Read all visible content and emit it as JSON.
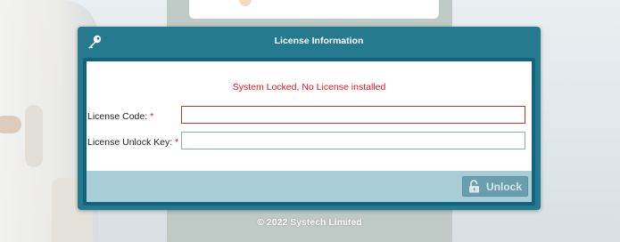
{
  "footer": {
    "copyright": "© 2022 Systech Limited"
  },
  "dialog": {
    "title": "License Information",
    "icon": "key-icon",
    "status_message": "System Locked, No License installed",
    "fields": [
      {
        "label": "License Code:",
        "required_mark": "*",
        "value": "",
        "placeholder": "",
        "state": "error"
      },
      {
        "label": "License Unlock Key:",
        "required_mark": "*",
        "value": "",
        "placeholder": "",
        "state": "normal"
      }
    ],
    "unlock_button": {
      "label": "Unlock",
      "icon": "unlock-icon",
      "enabled": false
    }
  },
  "colors": {
    "header": "#257a8f",
    "frame": "#10657c",
    "error_text": "#e0161c",
    "footer_bar": "#a9cdd6",
    "button": "#6a9eac"
  }
}
